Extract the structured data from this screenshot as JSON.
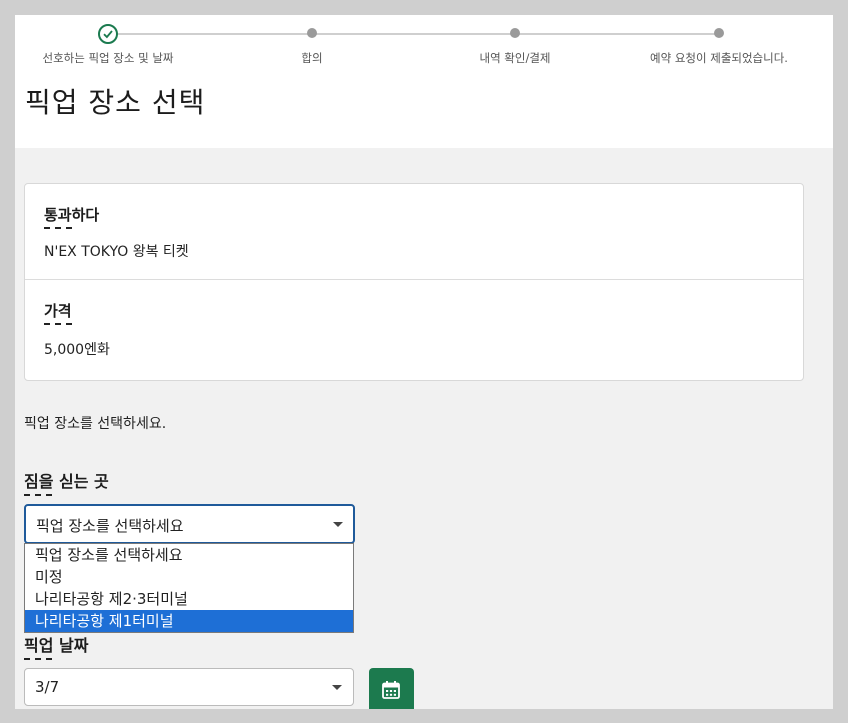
{
  "stepper": {
    "steps": [
      {
        "label": "선호하는 픽업 장소 및 날짜",
        "state": "completed"
      },
      {
        "label": "합의",
        "state": "pending"
      },
      {
        "label": "내역 확인/결제",
        "state": "pending"
      },
      {
        "label": "예약 요청이 제출되었습니다.",
        "state": "pending"
      }
    ],
    "completed_icon": "check-circle-icon"
  },
  "page": {
    "title": "픽업 장소 선택"
  },
  "summary": {
    "pass_label": "통과하다",
    "pass_value": "N'EX TOKYO 왕복 티켓",
    "price_label": "가격",
    "price_value": "5,000엔화"
  },
  "instruction": "픽업 장소를 선택하세요.",
  "pickup_location": {
    "label": "짐을 싣는 곳",
    "selected": "픽업 장소를 선택하세요",
    "options": [
      "픽업 장소를 선택하세요",
      "미정",
      "나리타공항 제2·3터미널",
      "나리타공항 제1터미널"
    ],
    "highlighted_index": 3
  },
  "pickup_date": {
    "label": "픽업 날짜",
    "selected": "3/7",
    "calendar_icon": "calendar-icon"
  },
  "colors": {
    "accent": "#1c7a4e",
    "focus": "#1f5a9a",
    "highlight": "#1e6fd6"
  }
}
